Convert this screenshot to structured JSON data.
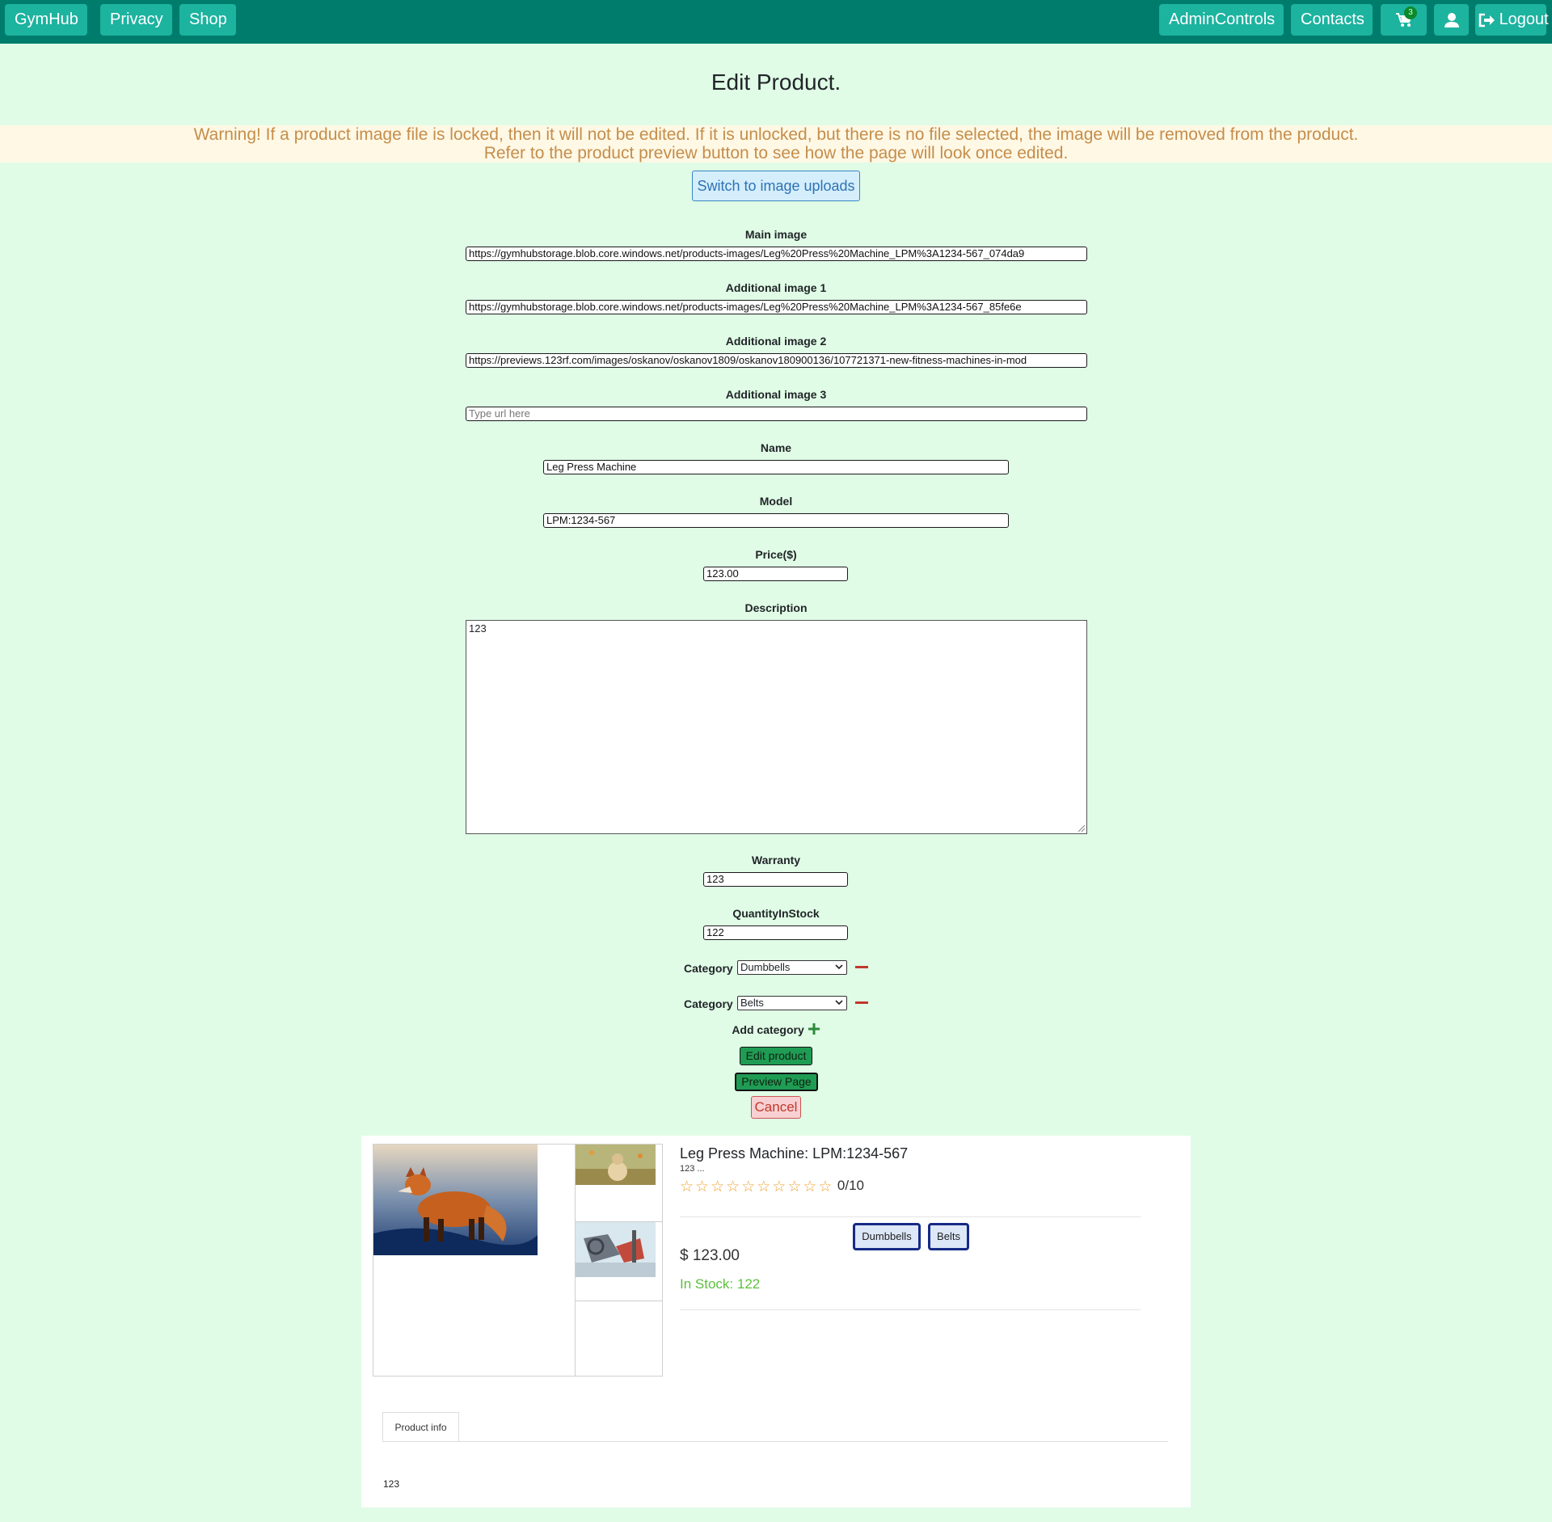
{
  "navbar": {
    "brand": "GymHub",
    "privacy": "Privacy",
    "shop": "Shop",
    "admin": "AdminControls",
    "contacts": "Contacts",
    "cart_count": "3",
    "logout": "Logout"
  },
  "page_title": "Edit Product.",
  "warning": {
    "line1": "Warning! If a product image file is locked, then it will not be edited. If it is unlocked, but there is no file selected, the image will be removed from the product.",
    "line2": "Refer to the product preview button to see how the page will look once edited."
  },
  "switch_button": "Switch to image uploads",
  "form": {
    "main_image": {
      "label": "Main image",
      "value": "https://gymhubstorage.blob.core.windows.net/products-images/Leg%20Press%20Machine_LPM%3A1234-567_074da9"
    },
    "additional_image_1": {
      "label": "Additional image 1",
      "value": "https://gymhubstorage.blob.core.windows.net/products-images/Leg%20Press%20Machine_LPM%3A1234-567_85fe6e"
    },
    "additional_image_2": {
      "label": "Additional image 2",
      "value": "https://previews.123rf.com/images/oskanov/oskanov1809/oskanov180900136/107721371-new-fitness-machines-in-mod"
    },
    "additional_image_3": {
      "label": "Additional image 3",
      "placeholder": "Type url here"
    },
    "name": {
      "label": "Name",
      "value": "Leg Press Machine"
    },
    "model": {
      "label": "Model",
      "value": "LPM:1234-567"
    },
    "price": {
      "label": "Price($)",
      "value": "123.00"
    },
    "description": {
      "label": "Description",
      "value": "123"
    },
    "warranty": {
      "label": "Warranty",
      "value": "123"
    },
    "quantity": {
      "label": "QuantityInStock",
      "value": "122"
    },
    "categories": [
      {
        "label": "Category",
        "selected": "Dumbbells"
      },
      {
        "label": "Category",
        "selected": "Belts"
      }
    ],
    "add_category": "Add category",
    "edit_button": "Edit product",
    "preview_button": "Preview Page",
    "cancel_button": "Cancel"
  },
  "preview": {
    "title": "Leg Press Machine: LPM:1234-567",
    "description_snippet": "123 ...",
    "rating": "0/10",
    "stars_total": 10,
    "stars_filled": 0,
    "tags": [
      "Dumbbells",
      "Belts"
    ],
    "price": "$ 123.00",
    "stock": "In Stock: 122",
    "tab_label": "Product info",
    "tab_content": "123"
  },
  "colors": {
    "page_bg": "#e0fce6",
    "navbar_bg": "#007c6c",
    "nav_button": "#1cb39f",
    "warning_text": "#c58d4b",
    "success_btn": "#1f9c54",
    "danger": "#c0392b",
    "stock_green": "#5dbf3d",
    "star": "#f0a33a"
  }
}
